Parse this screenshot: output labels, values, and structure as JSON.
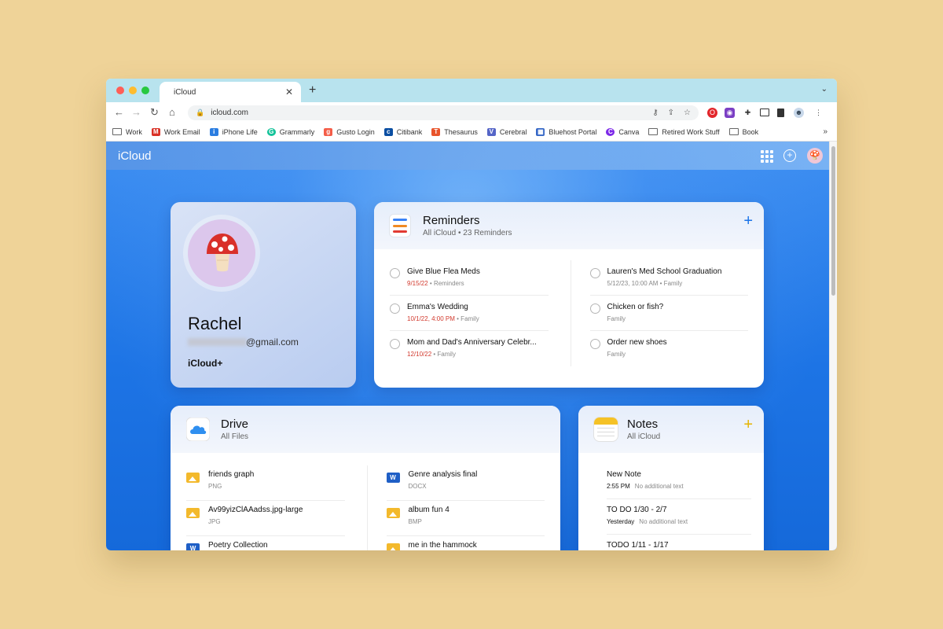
{
  "browser": {
    "tab_title": "iCloud",
    "tab_close": "✕",
    "new_tab": "+",
    "tab_menu": "⌄",
    "url": "icloud.com",
    "bookmarks": [
      {
        "label": "Work",
        "icon": "folder-icon",
        "color": ""
      },
      {
        "label": "Work Email",
        "icon": "gmail-icon",
        "color": "#d93025"
      },
      {
        "label": "iPhone Life",
        "icon": "iphonelife-icon",
        "color": "#2a7de1"
      },
      {
        "label": "Grammarly",
        "icon": "grammarly-icon",
        "color": "#15c39a"
      },
      {
        "label": "Gusto Login",
        "icon": "gusto-icon",
        "color": "#f45d48"
      },
      {
        "label": "Citibank",
        "icon": "citibank-icon",
        "color": "#0a4ea2"
      },
      {
        "label": "Thesaurus",
        "icon": "thesaurus-icon",
        "color": "#e8542b"
      },
      {
        "label": "Cerebral",
        "icon": "cerebral-icon",
        "color": "#5565c7"
      },
      {
        "label": "Bluehost Portal",
        "icon": "bluehost-icon",
        "color": "#3567c6"
      },
      {
        "label": "Canva",
        "icon": "canva-icon",
        "color": "#7d2ae8"
      },
      {
        "label": "Retired Work Stuff",
        "icon": "folder-icon",
        "color": ""
      },
      {
        "label": "Book",
        "icon": "folder-icon",
        "color": ""
      }
    ],
    "bookmarks_more": "»"
  },
  "icloud": {
    "brand": "iCloud"
  },
  "profile": {
    "name": "Rachel",
    "email_suffix": "@gmail.com",
    "plan": "iCloud+"
  },
  "reminders": {
    "title": "Reminders",
    "subtitle": "All iCloud • 23 Reminders",
    "plus": "+",
    "left": [
      {
        "title": "Give Blue Flea Meds",
        "date": "9/15/22",
        "list": " • Reminders"
      },
      {
        "title": "Emma's Wedding",
        "date": "10/1/22, 4:00 PM",
        "list": " • Family"
      },
      {
        "title": "Mom and Dad's Anniversary Celebr...",
        "date": "12/10/22",
        "list": " • Family"
      }
    ],
    "right": [
      {
        "title": "Lauren's Med School Graduation",
        "meta": "5/12/23, 10:00 AM • Family"
      },
      {
        "title": "Chicken or fish?",
        "meta": "Family"
      },
      {
        "title": "Order new shoes",
        "meta": "Family"
      }
    ]
  },
  "drive": {
    "title": "Drive",
    "subtitle": "All Files",
    "left": [
      {
        "name": "friends graph",
        "type": "PNG",
        "kind": "img"
      },
      {
        "name": "Av99yizClAAadss.jpg-large",
        "type": "JPG",
        "kind": "img"
      },
      {
        "name": "Poetry Collection",
        "type": "",
        "kind": "word"
      }
    ],
    "right": [
      {
        "name": "Genre analysis final",
        "type": "DOCX",
        "kind": "word"
      },
      {
        "name": "album fun 4",
        "type": "BMP",
        "kind": "img"
      },
      {
        "name": "me in the hammock",
        "type": "",
        "kind": "img"
      }
    ]
  },
  "notes": {
    "title": "Notes",
    "subtitle": "All iCloud",
    "plus": "+",
    "items": [
      {
        "title": "New Note",
        "when": "2:55 PM",
        "preview": "No additional text"
      },
      {
        "title": "TO DO 1/30 - 2/7",
        "when": "Yesterday",
        "preview": "No additional text"
      },
      {
        "title": "TODO 1/11 - 1/17",
        "when": "",
        "preview": ""
      }
    ]
  },
  "colors": {
    "accent_blue": "#1a73e8",
    "reminder_red": "#d23a2e",
    "notes_yellow": "#f5c226"
  }
}
